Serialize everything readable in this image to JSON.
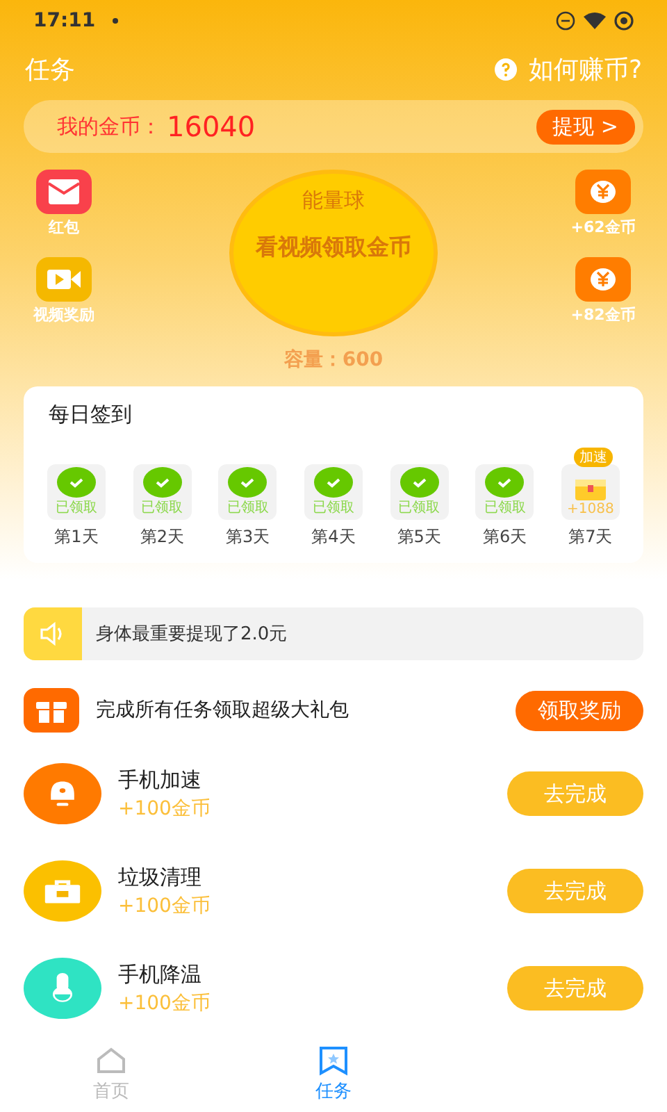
{
  "status_bar": {
    "time": "17:11"
  },
  "header": {
    "title": "任务",
    "help": "如何赚币?"
  },
  "balance": {
    "label": "我的金币：",
    "value": "16040",
    "button": "提现 >"
  },
  "left_actions": [
    {
      "kind": "envelope",
      "label": "红包"
    },
    {
      "kind": "video",
      "label": "视频奖励"
    }
  ],
  "right_actions": [
    {
      "kind": "coin",
      "label": "+62金币"
    },
    {
      "kind": "coin",
      "label": "+82金币"
    }
  ],
  "energy_ball": {
    "title": "能量球",
    "action": "看视频领取金币",
    "capacity": "容量：600"
  },
  "checkin": {
    "title": "每日签到",
    "days": [
      {
        "label": "第1天",
        "status": "已领取",
        "claimed": true
      },
      {
        "label": "第2天",
        "status": "已领取",
        "claimed": true
      },
      {
        "label": "第3天",
        "status": "已领取",
        "claimed": true
      },
      {
        "label": "第4天",
        "status": "已领取",
        "claimed": true
      },
      {
        "label": "第5天",
        "status": "已领取",
        "claimed": true
      },
      {
        "label": "第6天",
        "status": "已领取",
        "claimed": true
      },
      {
        "label": "第7天",
        "status": "+1088",
        "claimed": false,
        "badge": "加速"
      }
    ]
  },
  "notice": {
    "text": "身体最重要提现了2.0元"
  },
  "gift": {
    "text": "完成所有任务领取超级大礼包",
    "button": "领取奖励"
  },
  "tasks": [
    {
      "kind": "bell",
      "color": "#ff7a00",
      "title": "手机加速",
      "reward": "+100金币",
      "button": "去完成"
    },
    {
      "kind": "toolbox",
      "color": "#fbc000",
      "title": "垃圾清理",
      "reward": "+100金币",
      "button": "去完成"
    },
    {
      "kind": "thermometer",
      "color": "#2fe3c3",
      "title": "手机降温",
      "reward": "+100金币",
      "button": "去完成"
    }
  ],
  "nav": [
    {
      "kind": "home",
      "label": "首页",
      "selected": false
    },
    {
      "kind": "tasks",
      "label": "任务",
      "selected": true
    }
  ]
}
